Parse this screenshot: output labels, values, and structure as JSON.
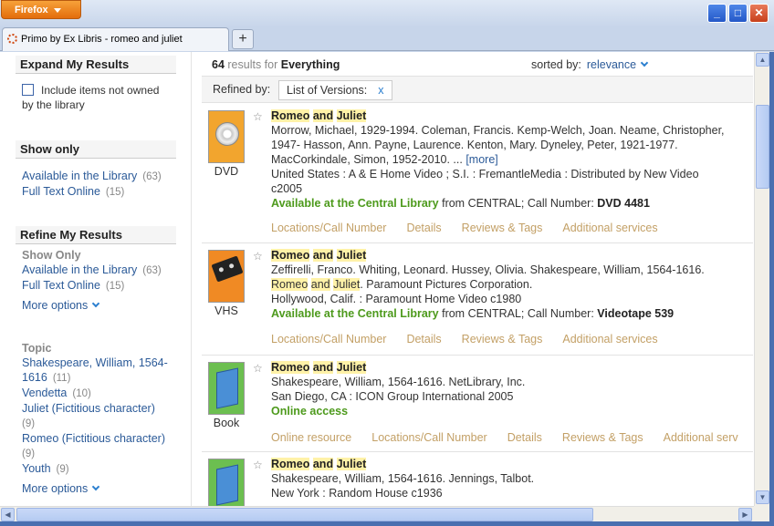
{
  "browser": {
    "app_button": "Firefox",
    "tab_title": "Primo by Ex Libris - romeo and juliet",
    "new_tab": "+",
    "window_buttons": {
      "minimize": "_",
      "maximize": "□",
      "close": "✕"
    }
  },
  "facets": {
    "expand_title": "Expand My Results",
    "include_not_owned": "Include items not owned by the library",
    "show_only_title": "Show only",
    "show_only": [
      {
        "label": "Available in the Library",
        "count": "(63)"
      },
      {
        "label": "Full Text Online",
        "count": "(15)"
      }
    ],
    "refine_title": "Refine My Results",
    "refine_show_only_label": "Show Only",
    "refine_show_only": [
      {
        "label": "Available in the Library",
        "count": "(63)"
      },
      {
        "label": "Full Text Online",
        "count": "(15)"
      }
    ],
    "more_options": "More options",
    "topic_label": "Topic",
    "topics": [
      {
        "label": "Shakespeare, William, 1564-1616",
        "count": "(11)"
      },
      {
        "label": "Vendetta",
        "count": "(10)"
      },
      {
        "label": "Juliet (Fictitious character)",
        "count": "(9)"
      },
      {
        "label": "Romeo (Fictitious character)",
        "count": "(9)"
      },
      {
        "label": "Youth",
        "count": "(9)"
      }
    ],
    "more_options_2": "More options"
  },
  "results": {
    "count": "64",
    "count_label": "results for",
    "scope": "Everything",
    "sort_label": "sorted by:",
    "sort_value": "relevance",
    "refined_by_label": "Refined by:",
    "refined_chip": "List of Versions:",
    "refined_chip_remove": "x",
    "records": [
      {
        "type": "DVD",
        "title_a": "Romeo",
        "title_b": "and",
        "title_c": "Juliet",
        "line1": "Morrow, Michael, 1929-1994. Coleman, Francis. Kemp-Welch, Joan. Neame, Christopher,",
        "line2": "1947- Hasson, Ann. Payne, Laurence. Kenton, Mary. Dyneley, Peter, 1921-1977.",
        "line3": "MacCorkindale, Simon, 1952-2010. ...",
        "more": "[more]",
        "line4": "United States : A & E Home Video ; S.I. : FremantleMedia : Distributed by New Video",
        "line5": "c2005",
        "avail": "Available at the Central Library",
        "avail_rest": " from CENTRAL; Call Number: ",
        "callno": "DVD 4481",
        "tabs": [
          "Locations/Call Number",
          "Details",
          "Reviews & Tags",
          "Additional services"
        ]
      },
      {
        "type": "VHS",
        "title_a": "Romeo",
        "title_b": "and",
        "title_c": "Juliet",
        "line1": "Zeffirelli, Franco. Whiting, Leonard. Hussey, Olivia. Shakespeare, William, 1564-1616.",
        "line2_a": "Romeo",
        "line2_b": "and",
        "line2_c": "Juliet",
        "line2_rest": ". Paramount Pictures Corporation.",
        "line3": "Hollywood, Calif. : Paramount Home Video c1980",
        "avail": "Available at the Central Library",
        "avail_rest": " from CENTRAL; Call Number: ",
        "callno": "Videotape 539",
        "tabs": [
          "Locations/Call Number",
          "Details",
          "Reviews & Tags",
          "Additional services"
        ]
      },
      {
        "type": "Book",
        "title_a": "Romeo",
        "title_b": "and",
        "title_c": "Juliet",
        "line1": "Shakespeare, William, 1564-1616. NetLibrary, Inc.",
        "line2": "San Diego, CA : ICON Group International 2005",
        "avail": "Online access",
        "tabs": [
          "Online resource",
          "Locations/Call Number",
          "Details",
          "Reviews & Tags",
          "Additional serv"
        ]
      },
      {
        "title_a": "Romeo",
        "title_b": "and",
        "title_c": "Juliet",
        "line1": "Shakespeare, William, 1564-1616. Jennings, Talbot.",
        "line2": "New York : Random House c1936"
      }
    ]
  },
  "icons": {
    "star": "☆",
    "arrow_up": "▲",
    "arrow_down": "▼",
    "arrow_left": "◀",
    "arrow_right": "▶"
  },
  "colors": {
    "link": "#2b5a98",
    "available": "#4d9a1c",
    "tab_link": "#c3a066",
    "highlight": "#fff2a8",
    "firefox_orange": "#e46d0c"
  }
}
